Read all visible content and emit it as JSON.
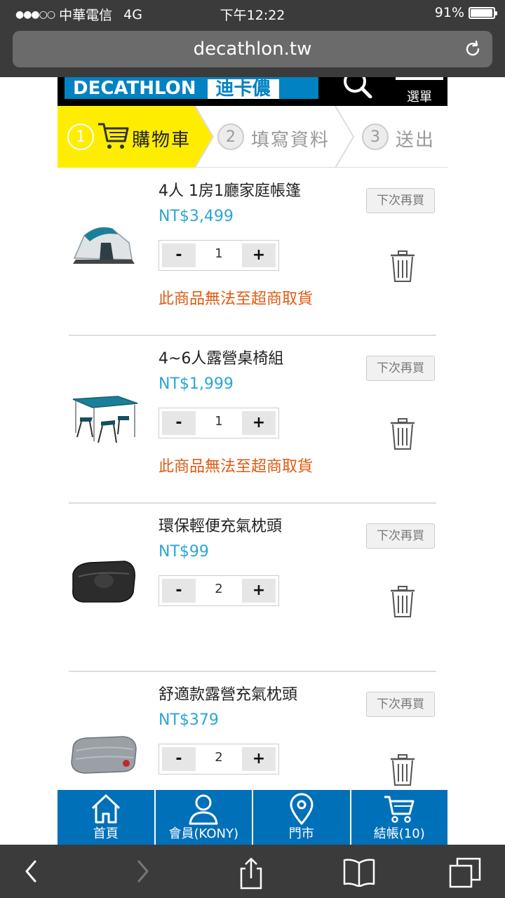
{
  "status_bar": {
    "carrier": "中華電信",
    "network": "4G",
    "time": "下午12:22",
    "battery": "91%",
    "battery_level": 0.91
  },
  "browser": {
    "url": "decathlon.tw"
  },
  "site_header": {
    "logo_en": "DECATHLON",
    "logo_cn": "迪卡儂",
    "menu_label": "選單"
  },
  "steps": [
    {
      "number": "1",
      "label": "購物車",
      "active": true
    },
    {
      "number": "2",
      "label": "填寫資料",
      "active": false
    },
    {
      "number": "3",
      "label": "送出",
      "active": false
    }
  ],
  "cart_items": [
    {
      "name": "4人 1房1廳家庭帳篷",
      "price": "NT$3,499",
      "quantity": "1",
      "warning": "此商品無法至超商取貨",
      "later_label": "下次再買",
      "image": "tent"
    },
    {
      "name": "4~6人露營桌椅組",
      "price": "NT$1,999",
      "quantity": "1",
      "warning": "此商品無法至超商取貨",
      "later_label": "下次再買",
      "image": "table-chairs"
    },
    {
      "name": "環保輕便充氣枕頭",
      "price": "NT$99",
      "quantity": "2",
      "warning": "",
      "later_label": "下次再買",
      "image": "pillow-dark"
    },
    {
      "name": "舒適款露營充氣枕頭",
      "price": "NT$379",
      "quantity": "2",
      "warning": "",
      "later_label": "下次再買",
      "image": "pillow-grey"
    }
  ],
  "qty_controls": {
    "minus": "-",
    "plus": "+"
  },
  "bottom_nav": [
    {
      "label": "首頁",
      "icon": "home-icon"
    },
    {
      "label": "會員(KONY)",
      "icon": "user-icon"
    },
    {
      "label": "門市",
      "icon": "location-pin-icon"
    },
    {
      "label": "結帳(10)",
      "icon": "cart-icon"
    }
  ],
  "colors": {
    "brand_blue": "#0082c3",
    "step_yellow": "#ffed00",
    "price_blue": "#2aa6d6",
    "warning_orange": "#e05a12",
    "nav_blue": "#0070b8"
  }
}
